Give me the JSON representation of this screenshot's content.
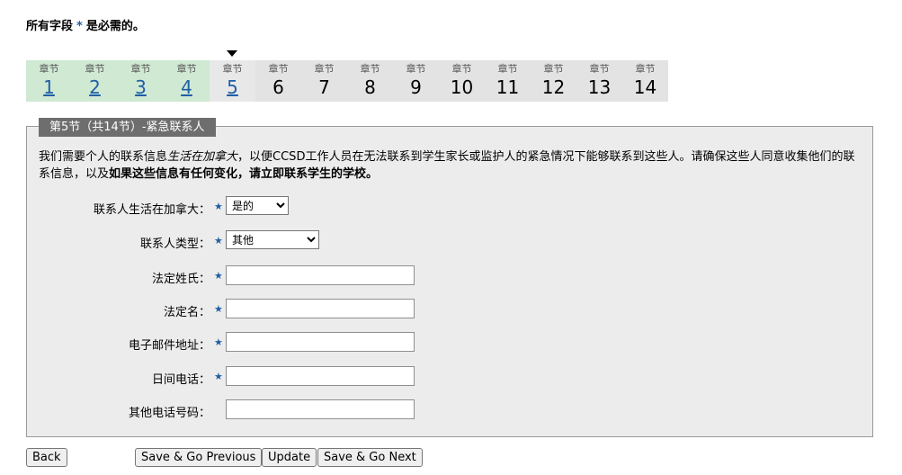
{
  "required_note": {
    "prefix": "所有字段",
    "star": "*",
    "suffix": "是必需的。"
  },
  "steps": {
    "label": "章节",
    "items": [
      {
        "num": "1",
        "state": "done"
      },
      {
        "num": "2",
        "state": "done"
      },
      {
        "num": "3",
        "state": "done"
      },
      {
        "num": "4",
        "state": "done"
      },
      {
        "num": "5",
        "state": "current"
      },
      {
        "num": "6",
        "state": "todo"
      },
      {
        "num": "7",
        "state": "todo"
      },
      {
        "num": "8",
        "state": "todo"
      },
      {
        "num": "9",
        "state": "todo"
      },
      {
        "num": "10",
        "state": "todo"
      },
      {
        "num": "11",
        "state": "todo"
      },
      {
        "num": "12",
        "state": "todo"
      },
      {
        "num": "13",
        "state": "todo"
      },
      {
        "num": "14",
        "state": "todo"
      }
    ]
  },
  "section": {
    "legend": "第5节（共14节）-紧急联系人",
    "intro_a": "我们需要个人的联系信息",
    "intro_italic": "生活在加拿大",
    "intro_b": "，以便CCSD工作人员在无法联系到学生家长或监护人的紧急情况下能够联系到这些人。请确保这些人同意收集他们的联系信息，以及",
    "intro_bold": "如果这些信息有任何变化，请立即联系学生的学校。"
  },
  "fields": {
    "lives_in_canada": {
      "label": "联系人生活在加拿大：",
      "value": "是的"
    },
    "contact_type": {
      "label": "联系人类型：",
      "value": "其他"
    },
    "last_name": {
      "label": "法定姓氏：",
      "value": ""
    },
    "first_name": {
      "label": "法定名：",
      "value": ""
    },
    "email": {
      "label": "电子邮件地址：",
      "value": ""
    },
    "day_phone": {
      "label": "日间电话：",
      "value": ""
    },
    "other_phone": {
      "label": "其他电话号码：",
      "value": ""
    }
  },
  "buttons": {
    "back": "Back",
    "save_prev": "Save & Go Previous",
    "update": "Update",
    "save_next": "Save & Go Next"
  },
  "colors": {
    "accent": "#1f5fa6",
    "done_bg": "#cfe9d3",
    "legend_bg": "#6e6e6e"
  }
}
